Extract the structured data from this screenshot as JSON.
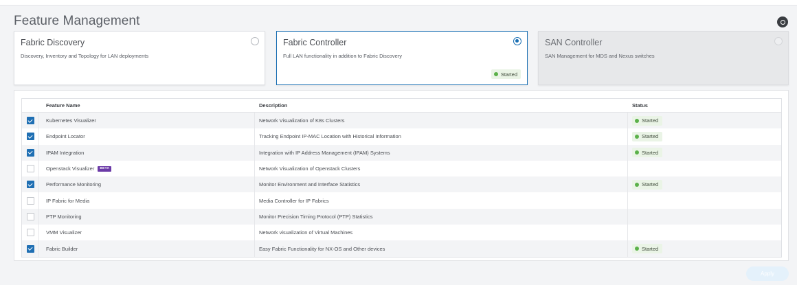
{
  "page": {
    "title": "Feature Management"
  },
  "cards": [
    {
      "title": "Fabric Discovery",
      "description": "Discovery, Inventory and Topology for LAN deployments",
      "selected": false,
      "disabled": false,
      "badge": ""
    },
    {
      "title": "Fabric Controller",
      "description": "Full LAN functionality in addition to Fabric Discovery",
      "selected": true,
      "disabled": false,
      "badge": "Started"
    },
    {
      "title": "SAN Controller",
      "description": "SAN Management for MDS and Nexus switches",
      "selected": false,
      "disabled": true,
      "badge": ""
    }
  ],
  "table": {
    "headers": {
      "name": "Feature Name",
      "description": "Description",
      "status": "Status"
    },
    "rows": [
      {
        "name": "Kubernetes Visualizer",
        "description": "Network Visualization of K8s Clusters",
        "status": "Started",
        "checked": true,
        "beta": ""
      },
      {
        "name": "Endpoint Locator",
        "description": "Tracking Endpoint IP-MAC Location with Historical Information",
        "status": "Started",
        "checked": true,
        "beta": ""
      },
      {
        "name": "IPAM Integration",
        "description": "Integration with IP Address Management (IPAM) Systems",
        "status": "Started",
        "checked": true,
        "beta": ""
      },
      {
        "name": "Openstack Visualizer",
        "description": "Network Visualization of Openstack Clusters",
        "status": "",
        "checked": false,
        "beta": "BETA"
      },
      {
        "name": "Performance Monitoring",
        "description": "Monitor Environment and Interface Statistics",
        "status": "Started",
        "checked": true,
        "beta": ""
      },
      {
        "name": "IP Fabric for Media",
        "description": "Media Controller for IP Fabrics",
        "status": "",
        "checked": false,
        "beta": ""
      },
      {
        "name": "PTP Monitoring",
        "description": "Monitor Precision Timing Protocol (PTP) Statistics",
        "status": "",
        "checked": false,
        "beta": ""
      },
      {
        "name": "VMM Visualizer",
        "description": "Network visualization of Virtual Machines",
        "status": "",
        "checked": false,
        "beta": ""
      },
      {
        "name": "Fabric Builder",
        "description": "Easy Fabric Functionality for NX-OS and Other devices",
        "status": "Started",
        "checked": true,
        "beta": ""
      }
    ]
  },
  "footer": {
    "apply_label": "Apply"
  },
  "colors": {
    "accent": "#1a6fb3",
    "started": "#5bb14a",
    "beta": "#6b3aa7"
  }
}
